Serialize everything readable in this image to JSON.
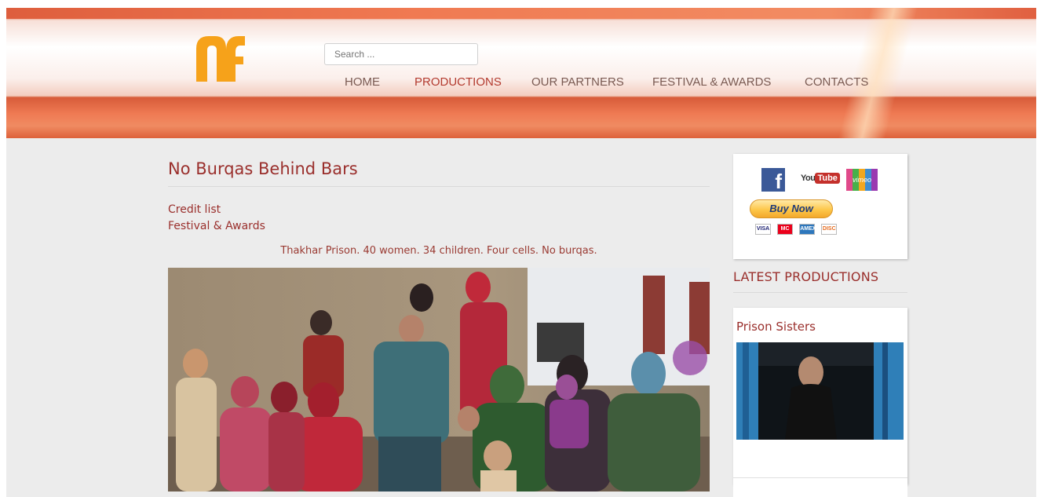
{
  "header": {
    "logo_alt": "NF logo",
    "search_placeholder": "Search ...",
    "nav": [
      {
        "label": "HOME",
        "active": false
      },
      {
        "label": "PRODUCTIONS",
        "active": true
      },
      {
        "label": "OUR PARTNERS",
        "active": false
      },
      {
        "label": "FESTIVAL & AWARDS",
        "active": false
      },
      {
        "label": "CONTACTS",
        "active": false
      }
    ]
  },
  "main": {
    "title": "No Burqas Behind Bars",
    "links": [
      "Credit list",
      "Festival & Awards"
    ],
    "tagline": "Thakhar Prison. 40 women. 34 children. Four cells. No burqas.",
    "photo_description": "group of women and children seated in prison courtyard with a uniformed officer"
  },
  "sidebar": {
    "social": [
      "facebook-icon",
      "youtube-icon",
      "vimeo-icon"
    ],
    "youtube_text": {
      "you": "You",
      "tube": "Tube"
    },
    "vimeo_text": "vimeo",
    "buy_now_label": "Buy Now",
    "payment_cards": [
      "VISA",
      "MC",
      "AMEX",
      "DISC"
    ],
    "latest_heading": "LATEST PRODUCTIONS",
    "latest_items": [
      {
        "title": "Prison Sisters"
      }
    ]
  },
  "colors": {
    "accent": "#9a2f2c",
    "header_orange": "#ee7a52",
    "logo_orange": "#f6a21a",
    "background": "#ececec"
  }
}
